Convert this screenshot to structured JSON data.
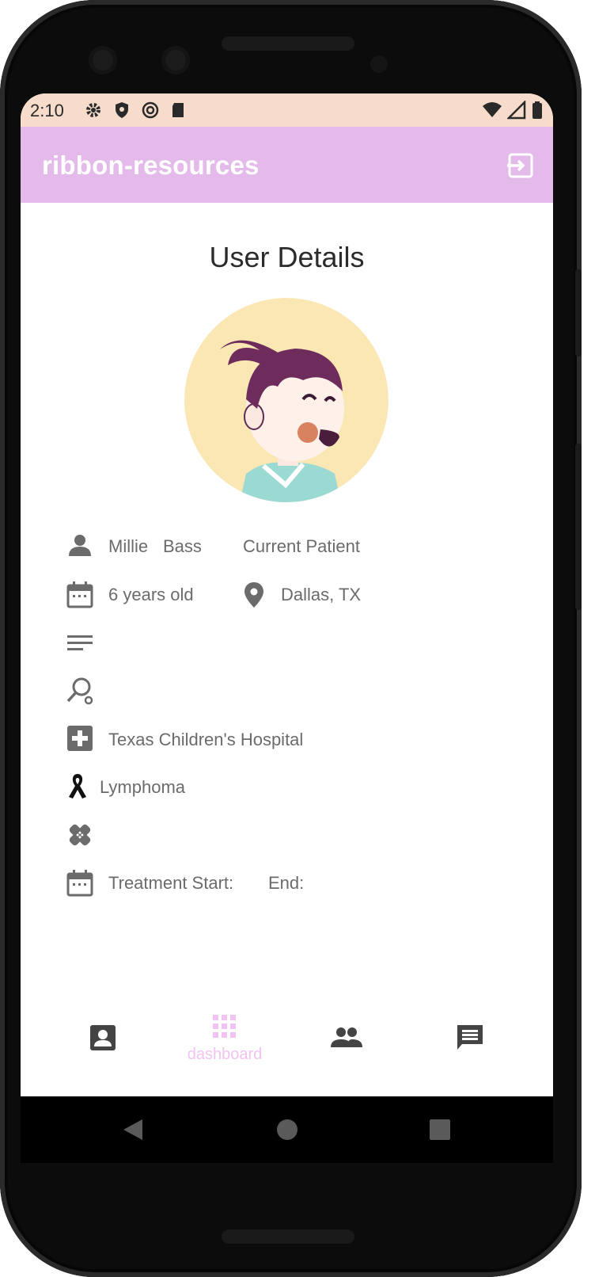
{
  "status_bar": {
    "time": "2:10",
    "left_icons": [
      "settings-icon",
      "shield-icon",
      "sync-icon",
      "sd-card-icon"
    ],
    "right_icons": [
      "wifi-icon",
      "cell-signal-icon",
      "battery-icon"
    ]
  },
  "app_bar": {
    "title": "ribbon-resources",
    "action_icon": "logout-icon",
    "color": "#e4baeb"
  },
  "page": {
    "heading": "User Details"
  },
  "details": {
    "first_name": "Millie",
    "last_name": "Bass",
    "status": "Current Patient",
    "age": "6 years old",
    "location": "Dallas, TX",
    "hospital": "Texas Children's Hospital",
    "diagnosis": "Lymphoma",
    "treatment_start_label": "Treatment Start:",
    "treatment_end_label": "End:"
  },
  "bottom_nav": {
    "items": [
      {
        "icon": "account-box-icon",
        "label": ""
      },
      {
        "icon": "dashboard-icon",
        "label": "dashboard",
        "active": true
      },
      {
        "icon": "people-icon",
        "label": ""
      },
      {
        "icon": "message-icon",
        "label": ""
      }
    ],
    "active_color": "#f0c3f2"
  },
  "system_nav": [
    "back-icon",
    "home-icon",
    "recents-icon"
  ]
}
